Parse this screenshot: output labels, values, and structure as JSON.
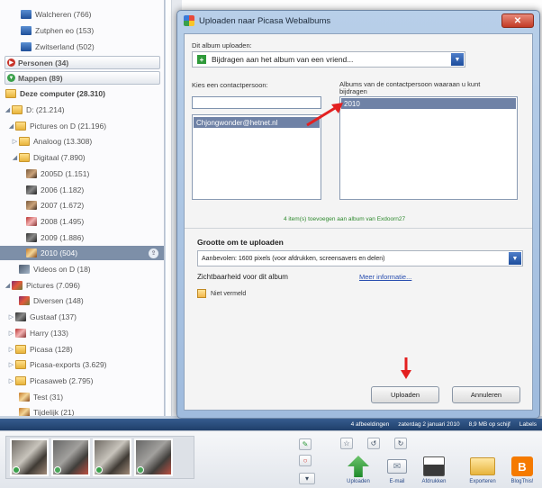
{
  "tree": {
    "items": [
      {
        "label": "Walcheren (766)",
        "icon": "album-icon"
      },
      {
        "label": "Zutphen eo (153)",
        "icon": "album-icon"
      },
      {
        "label": "Zwitserland (502)",
        "icon": "album-icon"
      }
    ],
    "sections": {
      "personen": "Personen (34)",
      "mappen": "Mappen (89)"
    },
    "computer": "Deze computer (28.310)",
    "folders": [
      {
        "label": "D: (21.214)",
        "toggle": "◢"
      },
      {
        "label": "Pictures on D (21.196)",
        "toggle": "◢"
      },
      {
        "label": "Analoog (13.308)",
        "toggle": "▷"
      },
      {
        "label": "Digitaal (7.890)",
        "toggle": "◢"
      },
      {
        "label": "2005D (1.151)",
        "toggle": ""
      },
      {
        "label": "2006 (1.182)",
        "toggle": ""
      },
      {
        "label": "2007 (1.672)",
        "toggle": ""
      },
      {
        "label": "2008 (1.495)",
        "toggle": ""
      },
      {
        "label": "2009 (1.886)",
        "toggle": ""
      },
      {
        "label": "2010 (504)",
        "toggle": ""
      },
      {
        "label": "Videos on D (18)",
        "toggle": ""
      },
      {
        "label": "Pictures (7.096)",
        "toggle": "◢"
      },
      {
        "label": "Diversen (148)",
        "toggle": ""
      },
      {
        "label": "Gustaaf (137)",
        "toggle": "▷"
      },
      {
        "label": "Harry (133)",
        "toggle": "▷"
      },
      {
        "label": "Picasa (128)",
        "toggle": "▷"
      },
      {
        "label": "Picasa-exports (3.629)",
        "toggle": "▷"
      },
      {
        "label": "Picasaweb (2.795)",
        "toggle": "▷"
      },
      {
        "label": "Test (31)",
        "toggle": ""
      },
      {
        "label": "Tijdelijk (21)",
        "toggle": ""
      }
    ]
  },
  "dialog": {
    "title": "Uploaden naar Picasa Webalbums",
    "close_glyph": "✕",
    "album_label": "Dit album uploaden:",
    "album_value": "Bijdragen aan het album van een vriend...",
    "contact_label": "Kies een contactpersoon:",
    "contact_input": "",
    "contact_selected": "Chjongwonder@hetnet.nl",
    "albums_label": "Albums van de contactpersoon waaraan u kunt bijdragen",
    "albums_selected": "2010",
    "green_message": "4 item(s) toevoegen aan album van Exdoorn27",
    "size_heading": "Grootte om te uploaden",
    "size_value": "Aanbevolen: 1600 pixels (voor afdrukken, screensavers en delen)",
    "visibility_heading": "Zichtbaarheid voor dit album",
    "more_info": "Meer informatie...",
    "not_listed": "Niet vermeld",
    "upload_button": "Uploaden",
    "cancel_button": "Annuleren"
  },
  "status_bar": {
    "count": "4 afbeeldingen",
    "date": "zaterdag 2 januari 2010",
    "disk": "8,9 MB op schijf",
    "labels": "Labels"
  },
  "tray": {
    "actions": [
      "Uploaden",
      "E-mail",
      "Afdrukken",
      "Exporteren",
      "BlogThis!"
    ]
  },
  "colors": {
    "selection": "#6f82a6",
    "status_bar": "#2a4c7c",
    "red_arrow": "#e32020",
    "link": "#2a4fb0"
  }
}
